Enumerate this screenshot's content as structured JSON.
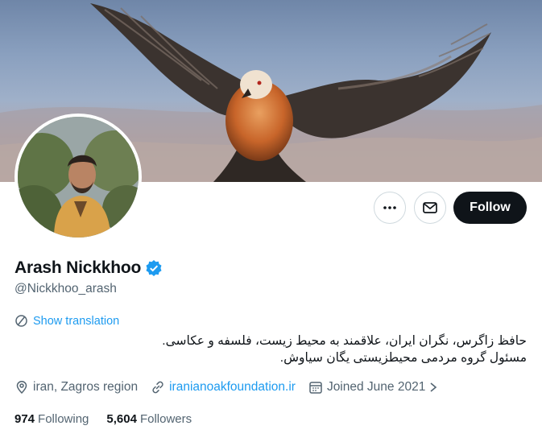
{
  "profile": {
    "display_name": "Arash Nickkhoo",
    "handle": "@Nickkhoo_arash",
    "verified": true,
    "translate_label": "Show translation",
    "bio_lines": [
      "حافظ زاگرس، نگران ایران، علاقمند به محیط زیست، فلسفه و عکاسی.",
      "مسئول گروه مردمی محیطزیستی یگان سیاوش."
    ],
    "location": "iran, Zagros region",
    "website": "iranianoakfoundation.ir",
    "joined": "Joined June 2021",
    "following_count": "974",
    "following_label": "Following",
    "followers_count": "5,604",
    "followers_label": "Followers"
  },
  "actions": {
    "follow_label": "Follow",
    "more_icon": "more-horizontal-icon",
    "message_icon": "envelope-icon"
  },
  "colors": {
    "accent": "#1d9bf0",
    "follow_bg": "#0f1419",
    "secondary_text": "#536471"
  }
}
